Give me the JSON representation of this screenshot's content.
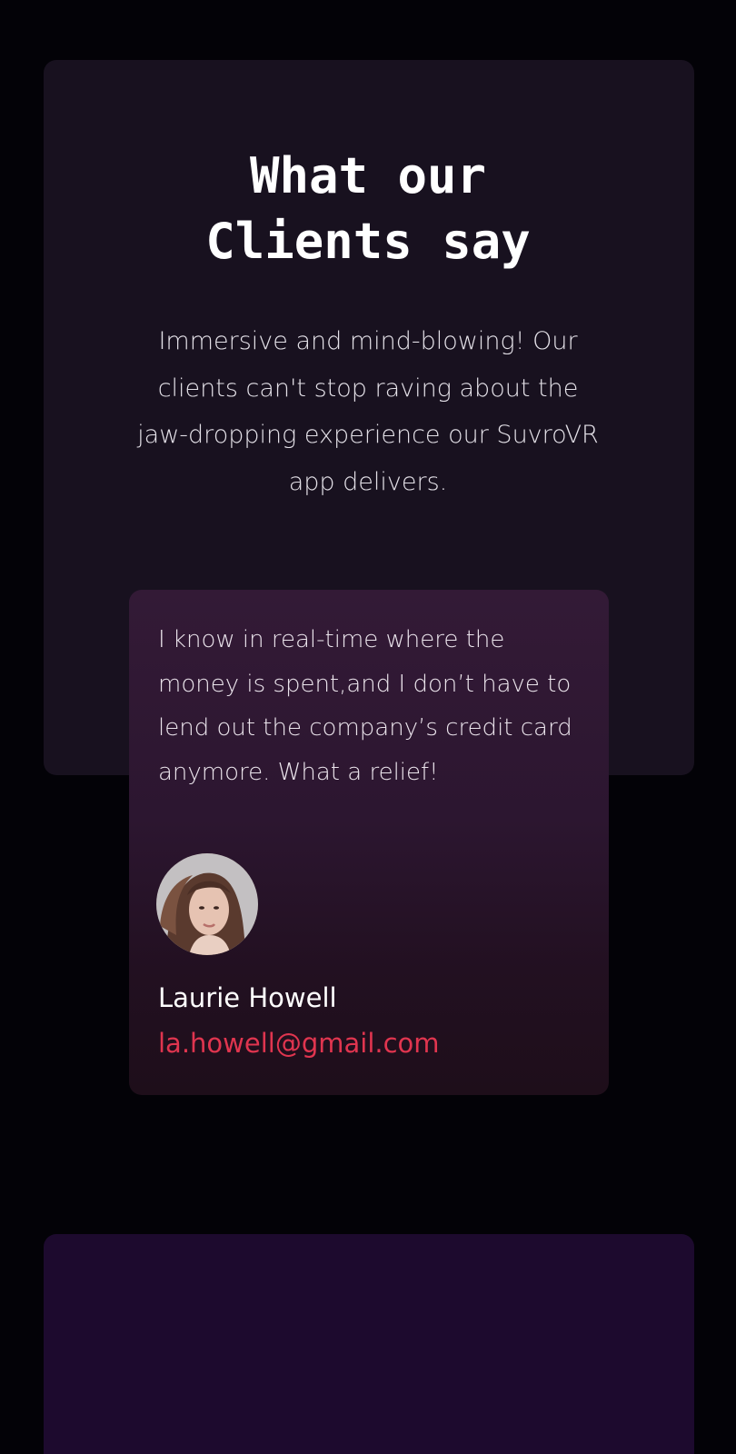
{
  "testimonials_section": {
    "title_line1": "What our",
    "title_line2": "Clients say",
    "subtitle": "Immersive and mind-blowing! Our clients can't stop raving about the jaw-dropping experience our SuvroVR app delivers.",
    "testimonial": {
      "quote": "I know in real-time where the money is spent,and I don’t have to lend out the company’s credit card anymore. What a relief!",
      "avatar_icon": "user-avatar-photo",
      "name": "Laurie Howell",
      "email": "la.howell@gmail.com"
    }
  },
  "colors": {
    "background": "#030207",
    "hero_card": "#18111f",
    "testimonial_card_top": "#331a36",
    "testimonial_card_bottom": "#1e0e1a",
    "email_accent": "#e0354f",
    "next_section_card": "#1d0a2e"
  }
}
